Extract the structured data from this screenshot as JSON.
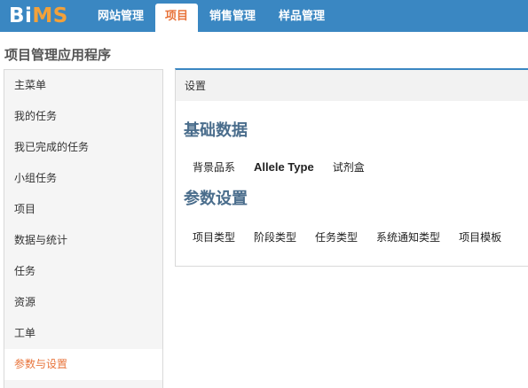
{
  "app": {
    "logo_main": "Bi",
    "logo_accent": "MS"
  },
  "nav": {
    "items": [
      {
        "label": "网站管理",
        "active": false
      },
      {
        "label": "项目",
        "active": true
      },
      {
        "label": "销售管理",
        "active": false
      },
      {
        "label": "样品管理",
        "active": false
      }
    ]
  },
  "page": {
    "title": "项目管理应用程序"
  },
  "sidebar": {
    "items": [
      {
        "label": "主菜单",
        "active": false
      },
      {
        "label": "我的任务",
        "active": false
      },
      {
        "label": "我已完成的任务",
        "active": false
      },
      {
        "label": "小组任务",
        "active": false
      },
      {
        "label": "项目",
        "active": false
      },
      {
        "label": "数据与统计",
        "active": false
      },
      {
        "label": "任务",
        "active": false
      },
      {
        "label": "资源",
        "active": false
      },
      {
        "label": "工单",
        "active": false
      },
      {
        "label": "参数与设置",
        "active": true
      }
    ]
  },
  "panel": {
    "header": "设置",
    "sections": [
      {
        "title": "基础数据",
        "links": [
          "背景品系",
          "Allele Type",
          "试剂盒"
        ]
      },
      {
        "title": "参数设置",
        "links": [
          "项目类型",
          "阶段类型",
          "任务类型",
          "系统通知类型",
          "项目模板"
        ]
      }
    ]
  },
  "colors": {
    "nav_bg": "#3a87c2",
    "accent": "#e8743b",
    "logo_accent": "#f2a13a",
    "section_title": "#4a6d8c"
  }
}
